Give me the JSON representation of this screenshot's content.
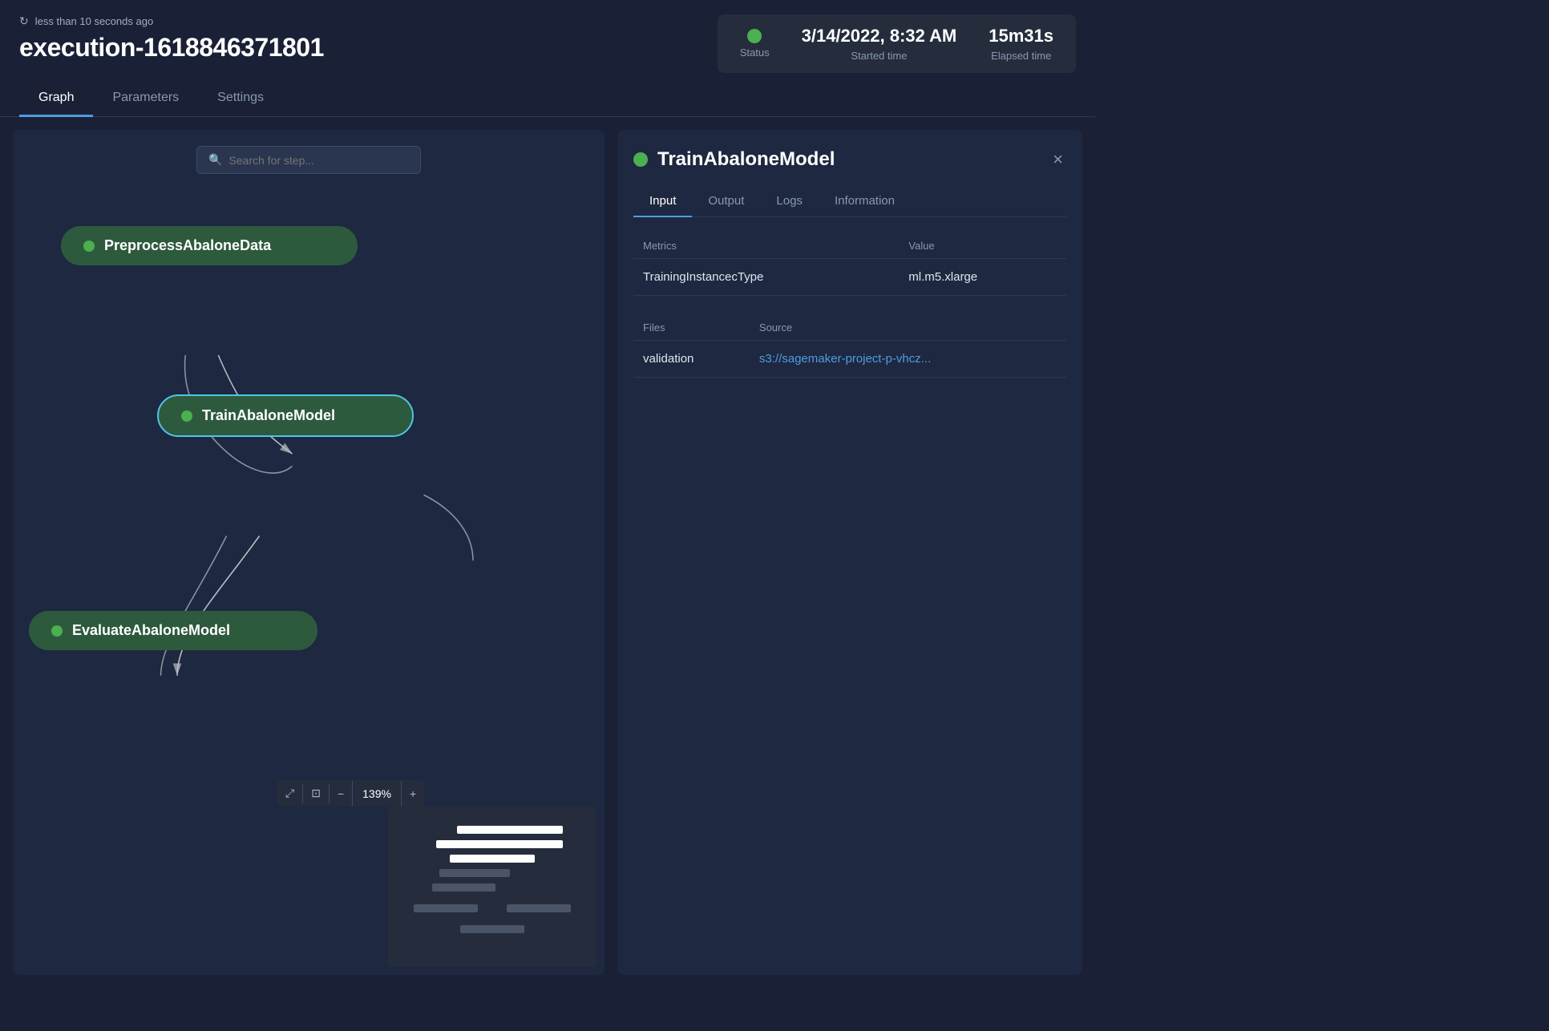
{
  "header": {
    "refresh_label": "less than 10 seconds ago",
    "execution_title": "execution-1618846371801",
    "status": {
      "label": "Status",
      "dot_color": "#4caf50"
    },
    "started_time": {
      "value": "3/14/2022, 8:32 AM",
      "label": "Started time"
    },
    "elapsed_time": {
      "value": "15m31s",
      "label": "Elapsed time"
    }
  },
  "tabs": {
    "items": [
      {
        "label": "Graph",
        "active": true
      },
      {
        "label": "Parameters",
        "active": false
      },
      {
        "label": "Settings",
        "active": false
      }
    ]
  },
  "graph": {
    "search_placeholder": "Search for step...",
    "nodes": [
      {
        "id": "preprocess",
        "label": "PreprocessAbaloneData"
      },
      {
        "id": "train",
        "label": "TrainAbaloneModel"
      },
      {
        "id": "evaluate",
        "label": "EvaluateAbaloneModel"
      }
    ],
    "zoom_value": "139%"
  },
  "detail_panel": {
    "title": "TrainAbaloneModel",
    "close_label": "×",
    "inner_tabs": [
      {
        "label": "Input",
        "active": true
      },
      {
        "label": "Output",
        "active": false
      },
      {
        "label": "Logs",
        "active": false
      },
      {
        "label": "Information",
        "active": false
      }
    ],
    "metrics_table": {
      "col_headers": [
        "Metrics",
        "Value"
      ],
      "rows": [
        {
          "metric": "TrainingInstancecType",
          "value": "ml.m5.xlarge"
        }
      ]
    },
    "files_table": {
      "col_headers": [
        "Files",
        "Source"
      ],
      "rows": [
        {
          "file": "validation",
          "source": "s3://sagemaker-project-p-vhcz..."
        }
      ]
    }
  }
}
